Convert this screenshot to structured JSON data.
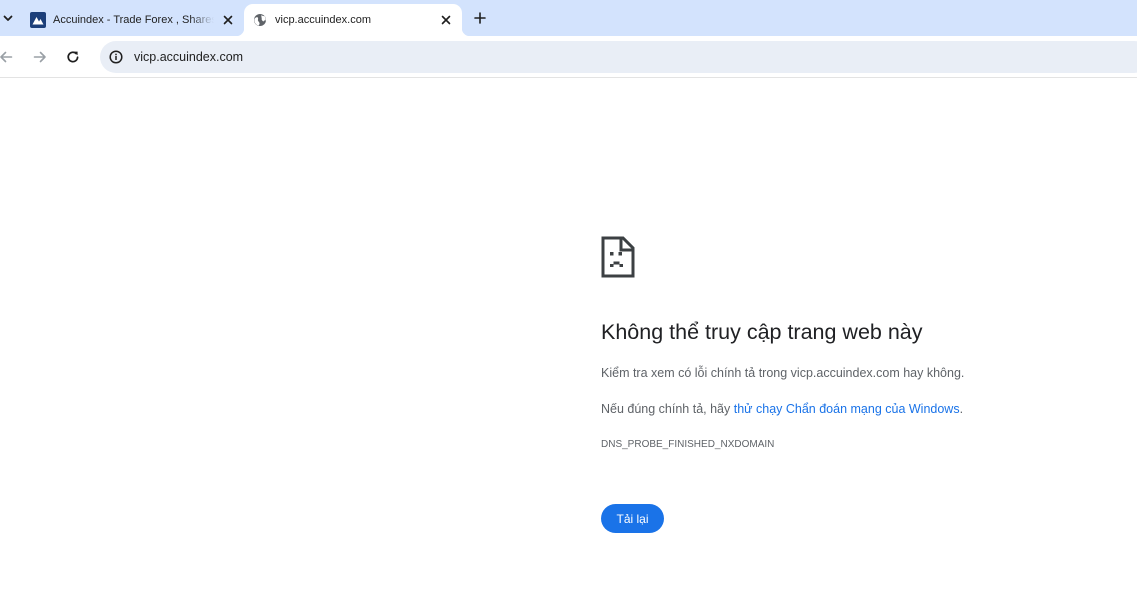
{
  "tabstrip": {
    "tabs": [
      {
        "title": "Accuindex - Trade Forex , Shares",
        "icon": "accuindex-logo-icon",
        "active": false
      },
      {
        "title": "vicp.accuindex.com",
        "icon": "globe-icon",
        "active": true
      }
    ],
    "tab_search_icon": "chevron-down-icon",
    "close_icon": "close-icon",
    "new_tab_icon": "plus-icon"
  },
  "toolbar": {
    "back_icon": "arrow-left-icon",
    "forward_icon": "arrow-right-icon",
    "reload_icon": "reload-icon",
    "site_info_icon": "info-icon",
    "url": "vicp.accuindex.com"
  },
  "error": {
    "icon": "sad-document-icon",
    "title": "Không thể truy cập trang web này",
    "check_line": "Kiểm tra xem có lỗi chính tả trong vicp.accuindex.com hay không.",
    "diag_prefix": "Nếu đúng chính tả, hãy ",
    "diag_link": "thử chạy Chẩn đoán mạng của Windows",
    "diag_suffix": ".",
    "code": "DNS_PROBE_FINISHED_NXDOMAIN",
    "reload_label": "Tải lại"
  },
  "colors": {
    "tabstrip_bg": "#d3e3fd",
    "omnibox_bg": "#e9eef6",
    "accent": "#1a73e8",
    "logo_bg": "#1c3f7a",
    "text_primary": "#202124",
    "text_secondary": "#5f6368"
  }
}
